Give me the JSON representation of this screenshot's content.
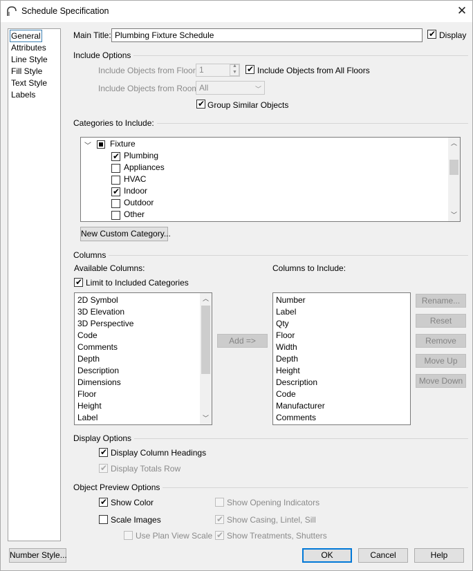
{
  "window": {
    "title": "Schedule Specification",
    "close": "✕"
  },
  "nav": {
    "items": [
      "General",
      "Attributes",
      "Line Style",
      "Fill Style",
      "Text Style",
      "Labels"
    ]
  },
  "general": {
    "main_title_label": "Main Title:",
    "main_title_value": "Plumbing Fixture Schedule",
    "display_label": "Display",
    "display_checked": true
  },
  "include_options": {
    "heading": "Include Options",
    "floor_label": "Include Objects from Floor:",
    "floor_value": "1",
    "all_floors_label": "Include Objects from All Floors",
    "room_label": "Include Objects from Room:",
    "room_value": "All",
    "group_label": "Group Similar Objects"
  },
  "categories": {
    "heading": "Categories to Include:",
    "root": "Fixture",
    "items": [
      {
        "label": "Plumbing",
        "checked": true
      },
      {
        "label": "Appliances",
        "checked": false
      },
      {
        "label": "HVAC",
        "checked": false
      },
      {
        "label": "Indoor",
        "checked": true
      },
      {
        "label": "Outdoor",
        "checked": false
      },
      {
        "label": "Other",
        "checked": false
      }
    ],
    "new_button": "New Custom Category..."
  },
  "columns": {
    "heading": "Columns",
    "available_label": "Available Columns:",
    "limit_label": "Limit to Included Categories",
    "available": [
      "2D Symbol",
      "3D Elevation",
      "3D Perspective",
      "Code",
      "Comments",
      "Depth",
      "Description",
      "Dimensions",
      "Floor",
      "Height",
      "Label"
    ],
    "add_button": "Add =>",
    "include_label": "Columns to Include:",
    "included": [
      "Number",
      "Label",
      "Qty",
      "Floor",
      "Width",
      "Depth",
      "Height",
      "Description",
      "Code",
      "Manufacturer",
      "Comments"
    ],
    "rename_button": "Rename...",
    "reset_button": "Reset",
    "remove_button": "Remove",
    "move_up_button": "Move Up",
    "move_down_button": "Move Down"
  },
  "display_options": {
    "heading": "Display Options",
    "column_headings": "Display Column Headings",
    "totals_row": "Display Totals Row"
  },
  "preview_options": {
    "heading": "Object Preview Options",
    "show_color": "Show Color",
    "scale_images": "Scale Images",
    "plan_view_scale": "Use Plan View Scale",
    "opening_indicators": "Show Opening Indicators",
    "casing": "Show Casing, Lintel, Sill",
    "treatments": "Show Treatments, Shutters"
  },
  "footer": {
    "number_style": "Number Style...",
    "ok": "OK",
    "cancel": "Cancel",
    "help": "Help"
  }
}
